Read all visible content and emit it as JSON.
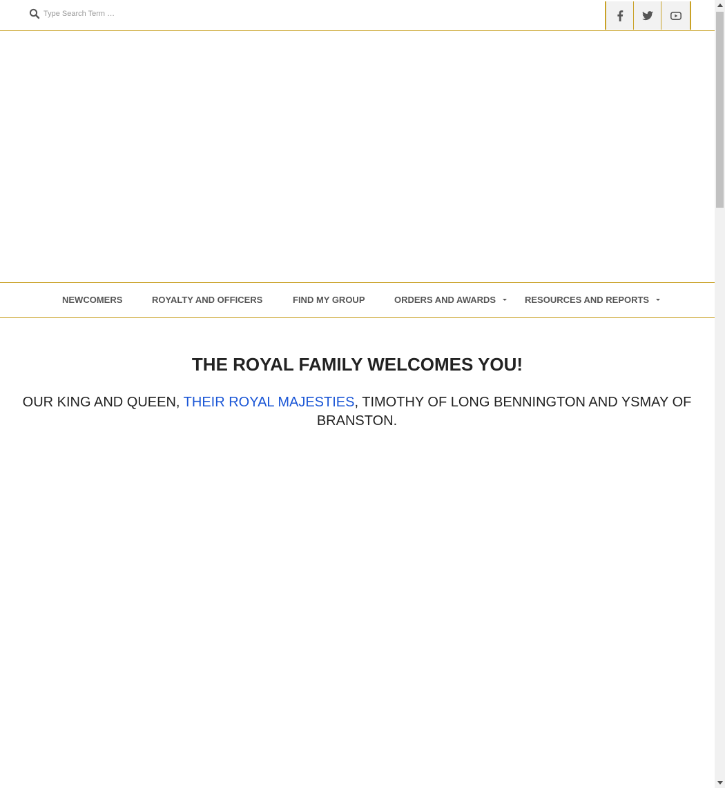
{
  "search": {
    "placeholder": "Type Search Term …"
  },
  "social": {
    "items": [
      {
        "name": "facebook",
        "icon": "facebook-icon"
      },
      {
        "name": "twitter",
        "icon": "twitter-icon"
      },
      {
        "name": "youtube",
        "icon": "youtube-icon"
      }
    ],
    "accent": "#c9a227"
  },
  "nav": {
    "items": [
      {
        "label": "NEWCOMERS",
        "has_dropdown": false
      },
      {
        "label": "ROYALTY AND OFFICERS",
        "has_dropdown": false
      },
      {
        "label": "FIND MY GROUP",
        "has_dropdown": false
      },
      {
        "label": "ORDERS AND AWARDS",
        "has_dropdown": true
      },
      {
        "label": "RESOURCES AND REPORTS",
        "has_dropdown": true
      }
    ]
  },
  "main": {
    "heading": "THE ROYAL FAMILY WELCOMES YOU!",
    "intro_before": "OUR KING AND QUEEN, ",
    "intro_link": "THEIR ROYAL MAJESTIES",
    "intro_after": ", TIMOTHY OF LONG BENNINGTON AND YSMAY OF BRANSTON."
  },
  "colors": {
    "border_gold": "#c9a227",
    "link_blue": "#1a56d6",
    "nav_text": "#555555",
    "heading_text": "#222222"
  }
}
